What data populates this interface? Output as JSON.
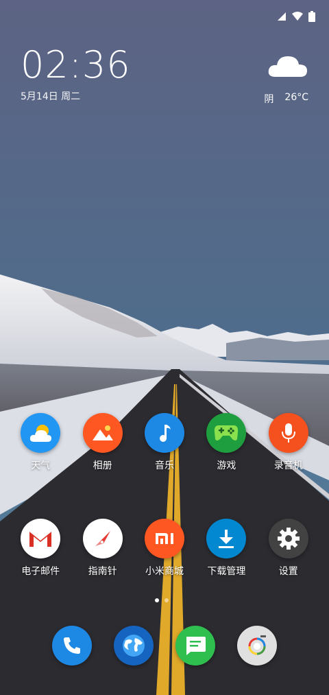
{
  "status_bar": {
    "signal_icon": "signal-icon",
    "wifi_icon": "wifi-icon",
    "battery_icon": "battery-icon"
  },
  "clock": {
    "time": "02:36",
    "date": "5月14日 周二"
  },
  "weather": {
    "icon": "cloud-icon",
    "condition": "阴",
    "temperature": "26°C"
  },
  "apps": [
    {
      "label": "天气",
      "icon": "weather-icon",
      "color": "#2196F3"
    },
    {
      "label": "相册",
      "icon": "gallery-icon",
      "color": "#FF5722"
    },
    {
      "label": "音乐",
      "icon": "music-icon",
      "color": "#1E88E5"
    },
    {
      "label": "游戏",
      "icon": "game-icon",
      "color": "#1E9E3E"
    },
    {
      "label": "录音机",
      "icon": "recorder-icon",
      "color": "#F4511E"
    },
    {
      "label": "电子邮件",
      "icon": "mail-icon",
      "color": "#FFFFFF"
    },
    {
      "label": "指南针",
      "icon": "compass-icon",
      "color": "#FFFFFF"
    },
    {
      "label": "小米商城",
      "icon": "mi-store-icon",
      "color": "#FF5722"
    },
    {
      "label": "下载管理",
      "icon": "download-icon",
      "color": "#0288D1"
    },
    {
      "label": "设置",
      "icon": "settings-icon",
      "color": "#424242"
    }
  ],
  "pager": {
    "pages": 2,
    "active": 1
  },
  "dock": [
    {
      "icon": "phone-icon",
      "color": "#1E88E5"
    },
    {
      "icon": "browser-icon",
      "color": "#1565C0"
    },
    {
      "icon": "messages-icon",
      "color": "#2EBF4F"
    },
    {
      "icon": "camera-icon",
      "color": "#E0E0E0"
    }
  ]
}
